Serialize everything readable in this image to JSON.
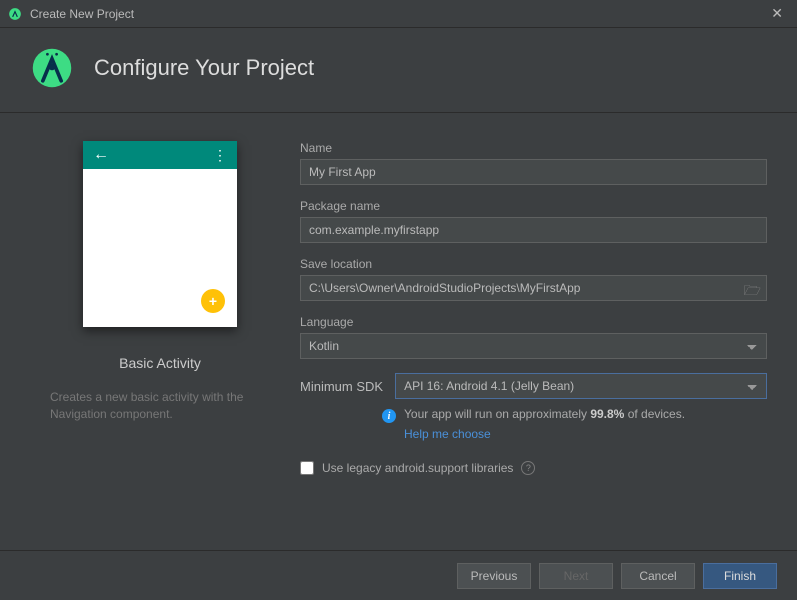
{
  "window": {
    "title": "Create New Project"
  },
  "header": {
    "title": "Configure Your Project"
  },
  "preview": {
    "template_name": "Basic Activity",
    "template_desc": "Creates a new basic activity with the Navigation component."
  },
  "form": {
    "name": {
      "label": "Name",
      "value": "My First App"
    },
    "package": {
      "label": "Package name",
      "value": "com.example.myfirstapp"
    },
    "save": {
      "label": "Save location",
      "value": "C:\\Users\\Owner\\AndroidStudioProjects\\MyFirstApp"
    },
    "language": {
      "label": "Language",
      "value": "Kotlin"
    },
    "sdk": {
      "label": "Minimum SDK",
      "value": "API 16: Android 4.1 (Jelly Bean)"
    },
    "info_prefix": "Your app will run on approximately ",
    "info_pct": "99.8%",
    "info_suffix": " of devices.",
    "help": "Help me choose",
    "legacy": "Use legacy android.support libraries"
  },
  "footer": {
    "previous": "Previous",
    "next": "Next",
    "cancel": "Cancel",
    "finish": "Finish"
  }
}
